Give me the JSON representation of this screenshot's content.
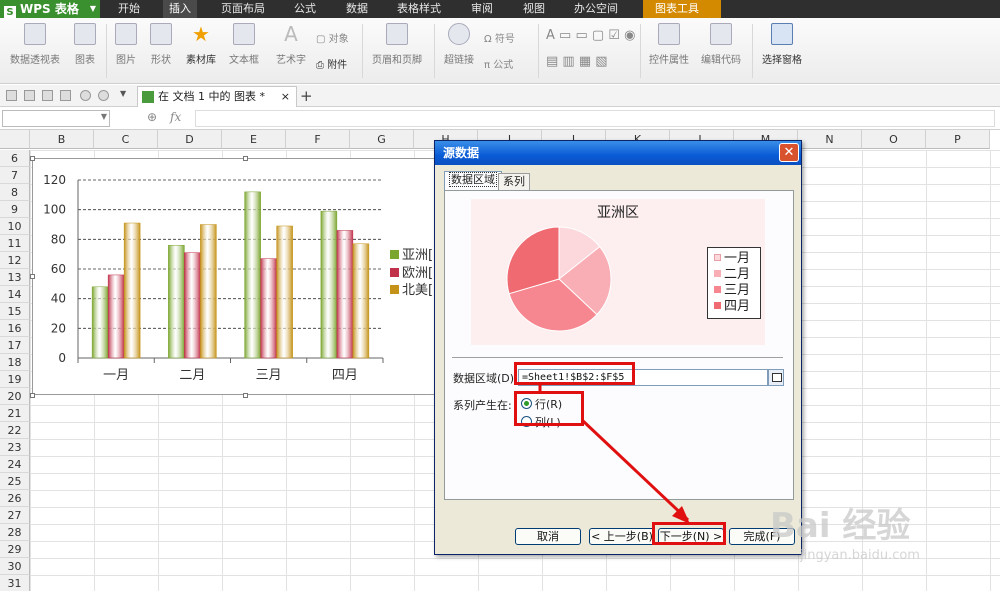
{
  "app": {
    "name": "WPS 表格",
    "logo_letter": "S"
  },
  "menu": {
    "items": [
      "开始",
      "插入",
      "页面布局",
      "公式",
      "数据",
      "表格样式",
      "审阅",
      "视图",
      "办公空间"
    ],
    "active": "插入",
    "chart_tools": "图表工具"
  },
  "ribbon": {
    "pivot_table": "数据透视表",
    "chart": "图表",
    "picture": "图片",
    "shapes": "形状",
    "clipart": "素材库",
    "textbox": "文本框",
    "wordart": "艺术字",
    "object": "对象",
    "attachment": "附件",
    "header_footer": "页眉和页脚",
    "hyperlink": "超链接",
    "symbol": "符号",
    "formula": "公式",
    "control_props": "控件属性",
    "edit_code": "编辑代码",
    "select_pane": "选择窗格",
    "form_letters": "A"
  },
  "doc_tab": {
    "label": "在 文档 1 中的 图表 *",
    "close": "×",
    "new": "+"
  },
  "formula_bar": {
    "fx": "fx",
    "zoom": "⊕"
  },
  "grid": {
    "columns": [
      "B",
      "C",
      "D",
      "E",
      "F",
      "G",
      "H",
      "I",
      "J",
      "K",
      "L",
      "M",
      "N",
      "O",
      "P"
    ],
    "rows": [
      "6",
      "7",
      "8",
      "9",
      "10",
      "11",
      "12",
      "13",
      "14",
      "15",
      "16",
      "17",
      "18",
      "19",
      "20",
      "21",
      "22",
      "23",
      "24",
      "25",
      "26",
      "27",
      "28",
      "29",
      "30",
      "31"
    ]
  },
  "chart_data": [
    {
      "type": "bar",
      "categories": [
        "一月",
        "二月",
        "三月",
        "四月"
      ],
      "series": [
        {
          "name": "亚洲区",
          "values": [
            48,
            76,
            112,
            99
          ]
        },
        {
          "name": "欧洲区",
          "values": [
            56,
            71,
            67,
            86
          ]
        },
        {
          "name": "北美区",
          "values": [
            91,
            90,
            89,
            77
          ]
        }
      ],
      "ylim": [
        0,
        120
      ],
      "yticks": [
        "0",
        "20",
        "40",
        "60",
        "80",
        "100",
        "120"
      ],
      "legend_labels": [
        "亚洲[",
        "欧洲[",
        "北美["
      ],
      "legend": "right",
      "grid": true,
      "colors": [
        "#7aa52e",
        "#c0314a",
        "#c49218"
      ]
    },
    {
      "type": "pie",
      "title": "亚洲区",
      "categories": [
        "一月",
        "二月",
        "三月",
        "四月"
      ],
      "values": [
        48,
        76,
        112,
        99
      ],
      "legend": "right",
      "colors": [
        "#fcd8dc",
        "#f9aeb5",
        "#f6868f",
        "#f06a72"
      ]
    }
  ],
  "dialog": {
    "title": "源数据",
    "close": "✕",
    "tabs": [
      "数据区域",
      "系列"
    ],
    "range_label": "数据区域(D):",
    "range_value": "=Sheet1!$B$2:$F$5",
    "series_in_label": "系列产生在:",
    "opt_row": "行(R)",
    "opt_col": "列(L)",
    "selected": "row",
    "btn_cancel": "取消",
    "btn_prev": "< 上一步(B)",
    "btn_next": "下一步(N) >",
    "btn_finish": "完成(F)"
  },
  "watermark": {
    "brand": "Bai  经验",
    "url": "jingyan.baidu.com"
  },
  "colors": {
    "annotation_red": "#e01010",
    "wps_green": "#3a8f2f",
    "title_blue": "#0a5bd6"
  }
}
